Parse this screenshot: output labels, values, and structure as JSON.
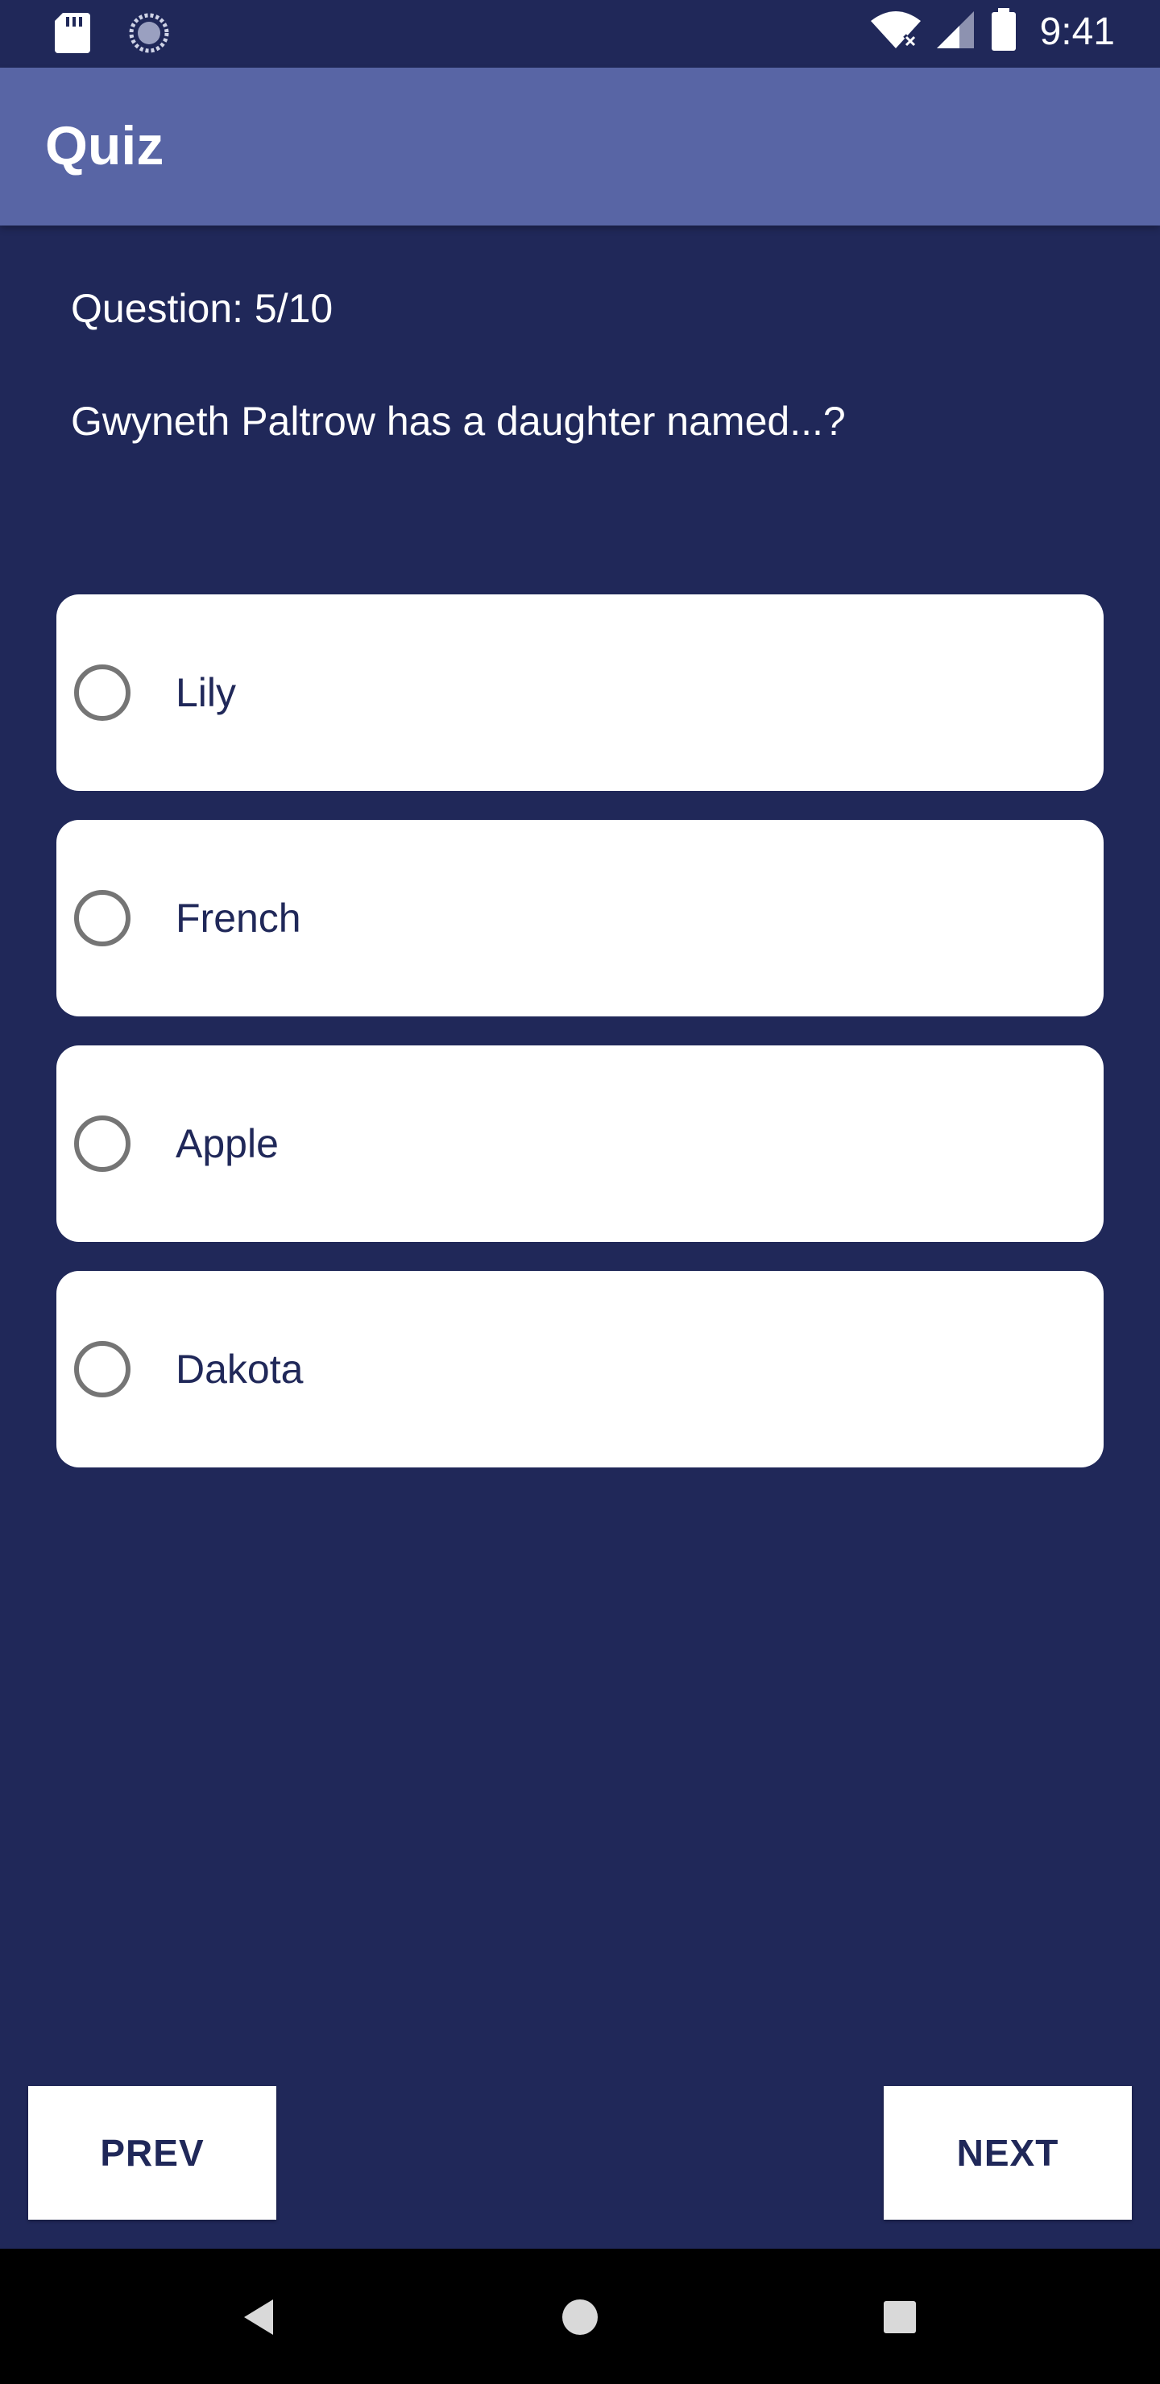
{
  "status_bar": {
    "time": "9:41",
    "icons": [
      "sd-card-icon",
      "sync-icon",
      "wifi-icon",
      "signal-icon",
      "battery-icon"
    ]
  },
  "app_bar": {
    "title": "Quiz"
  },
  "quiz": {
    "question_counter": "Question: 5/10",
    "question": "Gwyneth Paltrow has a daughter named...?",
    "options": [
      {
        "label": "Lily",
        "selected": false
      },
      {
        "label": "French",
        "selected": false
      },
      {
        "label": "Apple",
        "selected": false
      },
      {
        "label": "Dakota",
        "selected": false
      }
    ]
  },
  "buttons": {
    "prev": "PREV",
    "next": "NEXT"
  },
  "colors": {
    "background": "#202859",
    "app_bar": "#5865A5",
    "accent_text": "#202859",
    "card": "#ffffff"
  }
}
